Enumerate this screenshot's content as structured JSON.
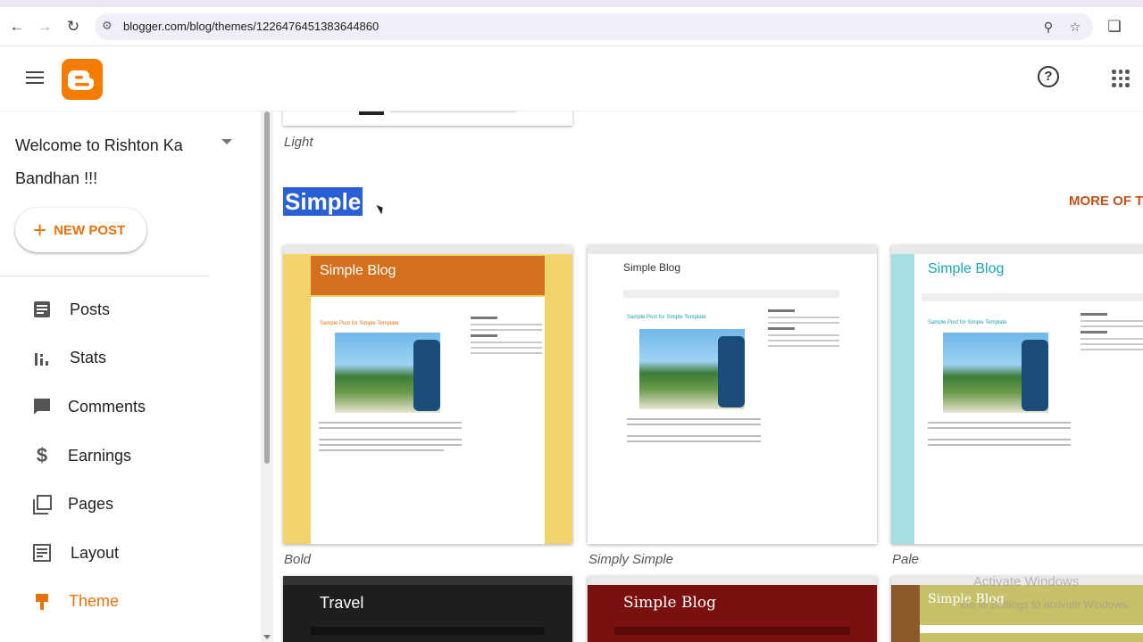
{
  "browser": {
    "url": "blogger.com/blog/themes/1226476451383644860"
  },
  "sidebar": {
    "blog_title": "Welcome to Rishton Ka Bandhan !!!",
    "new_post_label": "NEW POST",
    "items": [
      {
        "label": "Posts",
        "icon": "posts-icon"
      },
      {
        "label": "Stats",
        "icon": "stats-icon"
      },
      {
        "label": "Comments",
        "icon": "comments-icon"
      },
      {
        "label": "Earnings",
        "icon": "earnings-icon"
      },
      {
        "label": "Pages",
        "icon": "pages-icon"
      },
      {
        "label": "Layout",
        "icon": "layout-icon"
      },
      {
        "label": "Theme",
        "icon": "theme-icon",
        "active": true
      }
    ]
  },
  "content": {
    "prev_theme_label": "Light",
    "section_title": "Simple",
    "more_link": "MORE OF TH",
    "themes": [
      {
        "name": "Bold",
        "blog_title": "Simple Blog",
        "accent": "#d9731e",
        "bg": "#f1d36b"
      },
      {
        "name": "Simply Simple",
        "blog_title": "Simple Blog",
        "accent": "#1aa3b5",
        "bg": "#ffffff"
      },
      {
        "name": "Pale",
        "blog_title": "Simple Blog",
        "accent": "#1aa3b5",
        "bg": "#a6dfe3"
      }
    ],
    "row2": [
      {
        "blog_title": "Travel"
      },
      {
        "blog_title": "Simple Blog"
      },
      {
        "blog_title": "Simple Blog"
      }
    ],
    "post_title": "Sample Post for Simple Template",
    "watermark_title": "Activate Windows",
    "watermark_sub": "Go to Settings to activate Windows."
  },
  "colors": {
    "accent": "#e8710a",
    "logo": "#f57c00",
    "selection": "#2a5fd6"
  }
}
